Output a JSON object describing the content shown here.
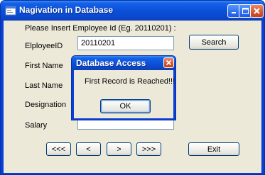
{
  "window": {
    "title": "Nagivation in Database",
    "titlebar_color": "#0b50d8"
  },
  "form": {
    "prompt": "Please Insert Employee Id (Eg. 20110201) :",
    "employee_id_label": "ElployeeID",
    "employee_id_value": "20110201",
    "search_label": "Search",
    "first_name_label": "First Name",
    "last_name_label": "Last Name",
    "designation_label": "Designation",
    "salary_label": "Salary",
    "nav": {
      "first": "<<<",
      "prev": "<",
      "next": ">",
      "last": ">>>"
    },
    "exit_label": "Exit"
  },
  "dialog": {
    "title": "Database Access",
    "message": "First Record is Reached!!!",
    "ok_label": "OK"
  }
}
